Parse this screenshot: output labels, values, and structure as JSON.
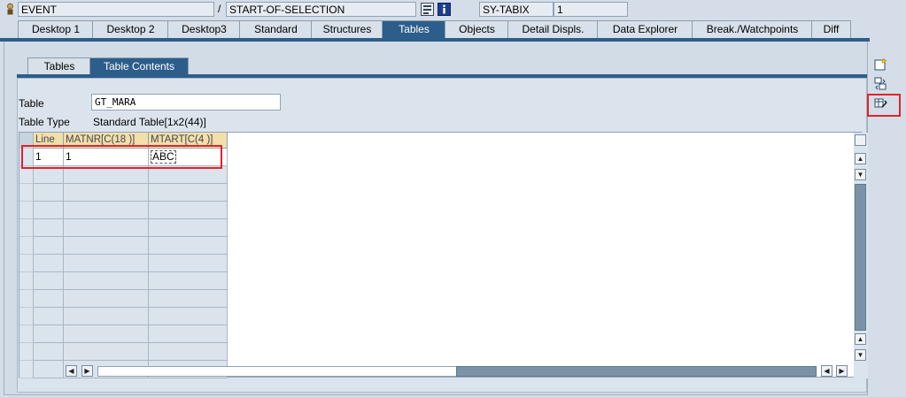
{
  "topbar": {
    "event_field": "EVENT",
    "separator": "/",
    "event_value": "START-OF-SELECTION",
    "variable_name": "SY-TABIX",
    "variable_value": "1"
  },
  "main_tabs": [
    {
      "label": "Desktop 1"
    },
    {
      "label": "Desktop 2"
    },
    {
      "label": "Desktop3"
    },
    {
      "label": "Standard"
    },
    {
      "label": "Structures"
    },
    {
      "label": "Tables"
    },
    {
      "label": "Objects"
    },
    {
      "label": "Detail Displs."
    },
    {
      "label": "Data Explorer"
    },
    {
      "label": "Break./Watchpoints"
    },
    {
      "label": "Diff"
    }
  ],
  "active_main_tab": "Tables",
  "sub_tabs": [
    {
      "label": "Tables"
    },
    {
      "label": "Table Contents"
    }
  ],
  "active_sub_tab": "Table Contents",
  "table_info": {
    "table_label": "Table",
    "table_value": "GT_MARA",
    "type_label": "Table Type",
    "type_value": "Standard Table[1x2(44)]"
  },
  "grid": {
    "columns": [
      {
        "label": "Line"
      },
      {
        "label": "MATNR[C(18 )]"
      },
      {
        "label": "MTART[C(4 )]"
      }
    ],
    "rows": [
      {
        "line": "1",
        "matnr": "1",
        "mtart": "ABC"
      }
    ]
  },
  "colors": {
    "accent": "#2d5d8a",
    "header_bg": "#f2dfa9",
    "highlight": "#e2222a",
    "background": "#d5dee8"
  },
  "icons": {
    "event_icon": "breakpoint-person-icon",
    "search_icon": "search-icon",
    "info_icon": "info-icon",
    "new_icon": "new-table-icon",
    "switch_icon": "switch-layout-icon",
    "change_icon": "edit-table-icon"
  }
}
